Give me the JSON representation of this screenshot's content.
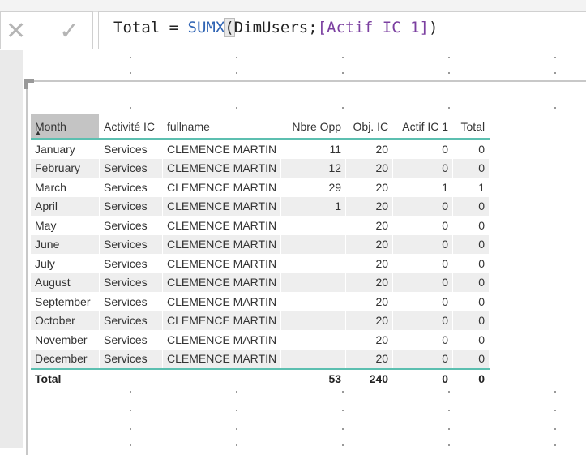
{
  "formula_bar": {
    "cancel_icon": "x-icon",
    "commit_icon": "check-icon",
    "formula": {
      "measure": "Total = ",
      "function": "SUMX",
      "open_paren": "(",
      "table": "DimUsers;",
      "reference": "[Actif IC 1]",
      "close": ")"
    }
  },
  "table": {
    "columns": [
      "Month",
      "Activité IC",
      "fullname",
      "Nbre Opp",
      "Obj. IC",
      "Actif IC 1",
      "Total"
    ],
    "sort_column": "Month",
    "sort_direction": "ascending",
    "rows": [
      [
        "January",
        "Services",
        "CLEMENCE MARTIN",
        "11",
        "20",
        "0",
        "0"
      ],
      [
        "February",
        "Services",
        "CLEMENCE MARTIN",
        "12",
        "20",
        "0",
        "0"
      ],
      [
        "March",
        "Services",
        "CLEMENCE MARTIN",
        "29",
        "20",
        "1",
        "1"
      ],
      [
        "April",
        "Services",
        "CLEMENCE MARTIN",
        "1",
        "20",
        "0",
        "0"
      ],
      [
        "May",
        "Services",
        "CLEMENCE MARTIN",
        "",
        "20",
        "0",
        "0"
      ],
      [
        "June",
        "Services",
        "CLEMENCE MARTIN",
        "",
        "20",
        "0",
        "0"
      ],
      [
        "July",
        "Services",
        "CLEMENCE MARTIN",
        "",
        "20",
        "0",
        "0"
      ],
      [
        "August",
        "Services",
        "CLEMENCE MARTIN",
        "",
        "20",
        "0",
        "0"
      ],
      [
        "September",
        "Services",
        "CLEMENCE MARTIN",
        "",
        "20",
        "0",
        "0"
      ],
      [
        "October",
        "Services",
        "CLEMENCE MARTIN",
        "",
        "20",
        "0",
        "0"
      ],
      [
        "November",
        "Services",
        "CLEMENCE MARTIN",
        "",
        "20",
        "0",
        "0"
      ],
      [
        "December",
        "Services",
        "CLEMENCE MARTIN",
        "",
        "20",
        "0",
        "0"
      ]
    ],
    "total": [
      "Total",
      "",
      "",
      "53",
      "240",
      "0",
      "0"
    ],
    "accent_color": "#5cbfb0"
  }
}
